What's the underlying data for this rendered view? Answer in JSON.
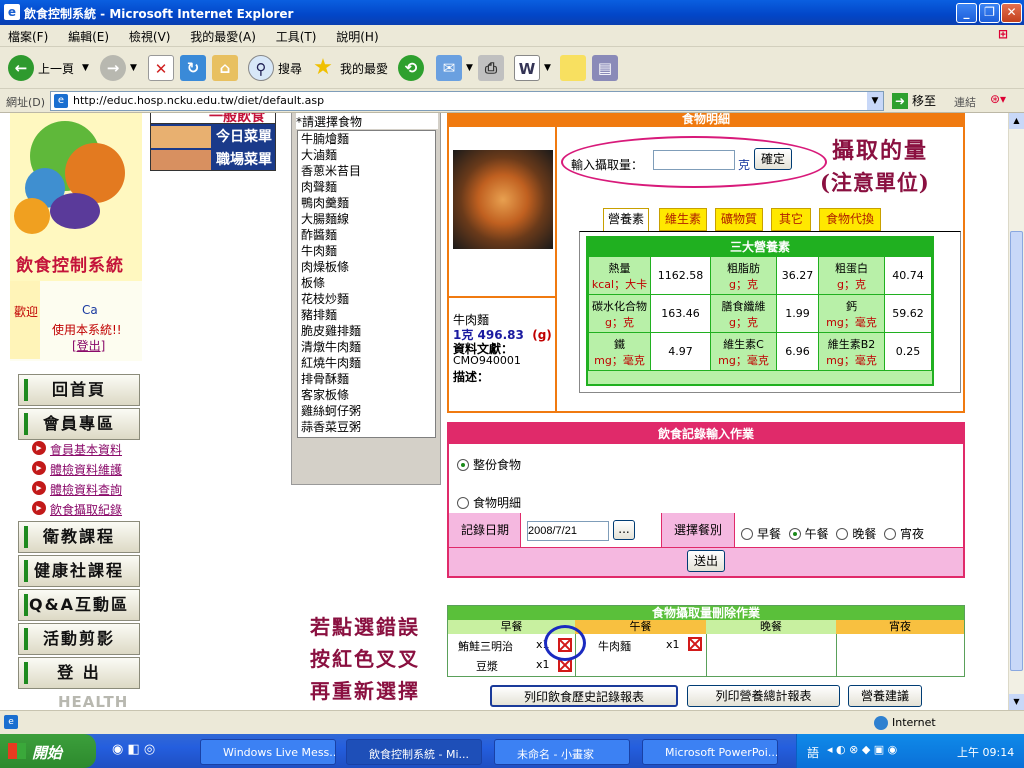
{
  "window": {
    "title": "飲食控制系統 - Microsoft Internet Explorer"
  },
  "menu": [
    "檔案(F)",
    "編輯(E)",
    "檢視(V)",
    "我的最愛(A)",
    "工具(T)",
    "說明(H)"
  ],
  "toolbar": {
    "back": "上一頁",
    "search": "搜尋",
    "favorites": "我的最愛"
  },
  "address": {
    "label": "網址(D)",
    "url": "http://educ.hosp.ncku.edu.tw/diet/default.asp",
    "go": "移至",
    "links": "連結"
  },
  "sidebar": {
    "logo_title": "飲食控制系統",
    "banner_top": "一般飲食",
    "banner_today": "今日菜單",
    "banner_work": "職場菜單",
    "welcome": "歡迎",
    "user": "Ca",
    "use_system": "使用本系統!!",
    "logout": "[登出]",
    "nav": [
      "回首頁",
      "會員專區",
      "衛教課程",
      "健康社課程",
      "Q&A互動區",
      "活動剪影",
      "登 出"
    ],
    "sublinks": [
      "會員基本資料",
      "體檢資料維護",
      "體檢資料查詢",
      "飲食攝取紀錄"
    ],
    "health": "HEALTH"
  },
  "foodlist": {
    "header": "*請選擇食物",
    "items": [
      "牛腩燴麵",
      "大滷麵",
      "香蔥米苔目",
      "肉聲麵",
      "鴨肉羹麵",
      "大腸麵線",
      "酢醬麵",
      "牛肉麵",
      "肉燥板條",
      "板條",
      "花枝炒麵",
      "豬排麵",
      "脆皮雞排麵",
      "清燉牛肉麵",
      "紅燒牛肉麵",
      "排骨酥麵",
      "客家板條",
      "雞絲蚵仔粥",
      "蒜香菜豆粥"
    ]
  },
  "detail": {
    "header": "食物明細",
    "intake_label": "輸入攝取量：",
    "intake_value": "",
    "unit": "克",
    "confirm": "確定",
    "food_name": "牛肉麵",
    "serving_prefix": "1克",
    "serving_value": "496.83",
    "serving_unit": "(g)",
    "source_label": "資料文獻：",
    "source_code": "CMO940001",
    "desc_label": "描述：",
    "tabs": [
      "營養素",
      "維生素",
      "礦物質",
      "其它",
      "食物代換"
    ],
    "table_title": "三大營養素",
    "rows": [
      [
        {
          "name": "熱量",
          "unit": "kcal；大卡",
          "val": "1162.58"
        },
        {
          "name": "粗脂肪",
          "unit": "g；克",
          "val": "36.27"
        },
        {
          "name": "粗蛋白",
          "unit": "g；克",
          "val": "40.74"
        }
      ],
      [
        {
          "name": "碳水化合物",
          "unit": "g；克",
          "val": "163.46"
        },
        {
          "name": "膳食纖維",
          "unit": "g；克",
          "val": "1.99"
        },
        {
          "name": "鈣",
          "unit": "mg；毫克",
          "val": "59.62"
        }
      ],
      [
        {
          "name": "鐵",
          "unit": "mg；毫克",
          "val": "4.97"
        },
        {
          "name": "維生素C",
          "unit": "mg；毫克",
          "val": "6.96"
        },
        {
          "name": "維生素B2",
          "unit": "mg；毫克",
          "val": "0.25"
        }
      ]
    ]
  },
  "record": {
    "header": "飲食記錄輸入作業",
    "opt_whole": "整份食物",
    "opt_detail": "食物明細",
    "date_label": "記錄日期",
    "date_value": "2008/7/21",
    "date_btn": "...",
    "meal_label": "選擇餐別",
    "meals": [
      "早餐",
      "午餐",
      "晚餐",
      "宵夜"
    ],
    "submit": "送出"
  },
  "intake": {
    "header": "食物攝取量刪除作業",
    "cols": [
      "早餐",
      "午餐",
      "晚餐",
      "宵夜"
    ],
    "breakfast": [
      {
        "name": "鮪鮭三明治",
        "qty": "x1"
      },
      {
        "name": "豆漿",
        "qty": "x1"
      }
    ],
    "lunch": [
      {
        "name": "牛肉麵",
        "qty": "x1"
      }
    ]
  },
  "buttons": {
    "print_history": "列印飲食歷史記錄報表",
    "print_summary": "列印營養總計報表",
    "advice": "營養建議"
  },
  "annotations": {
    "amount_line1": "攝取的量",
    "amount_line2": "(注意單位)",
    "wrong_line1": "若點選錯誤",
    "wrong_line2": "按紅色叉叉",
    "wrong_line3": "再重新選擇"
  },
  "status": {
    "zone": "Internet"
  },
  "taskbar": {
    "start": "開始",
    "tasks": [
      "Windows Live Mess...",
      "飲食控制系統 - Mi...",
      "未命名 - 小畫家",
      "Microsoft PowerPoi..."
    ],
    "ime": "語",
    "clock": "上午 09:14"
  }
}
